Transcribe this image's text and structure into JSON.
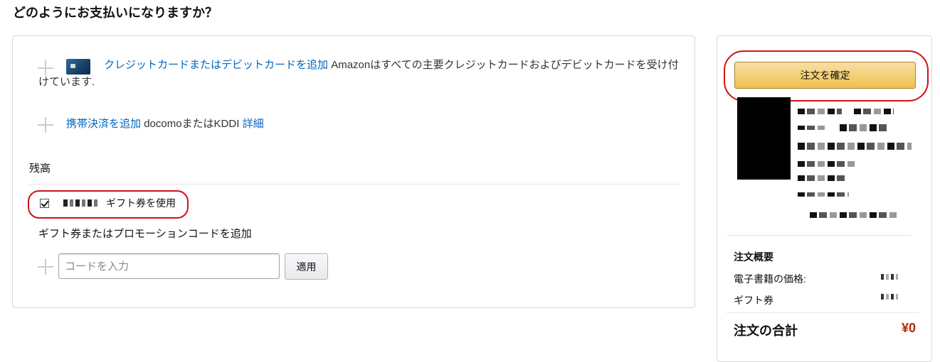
{
  "page": {
    "title": "どのようにお支払いになりますか？"
  },
  "payment": {
    "card": {
      "add_link": "クレジットカードまたはデビットカードを追加",
      "description": "Amazonはすべての主要クレジットカードおよびデビットカードを受け付けています."
    },
    "mobile": {
      "add_link": "携帯決済を追加",
      "carriers": "docomoまたはKDDI",
      "details_link": "詳細"
    },
    "balance": {
      "section_label": "残高",
      "use_gift_label": "ギフト券を使用",
      "use_gift_checked": true
    },
    "promo": {
      "label": "ギフト券またはプロモーションコードを追加",
      "placeholder": "コードを入力",
      "apply_label": "適用"
    }
  },
  "order_summary": {
    "place_order_label": "注文を確定",
    "summary_title": "注文概要",
    "ebook_price_label": "電子書籍の価格:",
    "gift_card_label": "ギフト券",
    "total_label": "注文の合計",
    "total_value": "¥0"
  },
  "colors": {
    "link": "#0066c0",
    "highlight_oval": "#d0111b",
    "price": "#b12704",
    "primary_button": "#f0c14b"
  }
}
